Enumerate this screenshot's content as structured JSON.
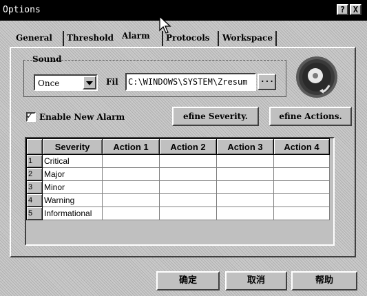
{
  "window": {
    "title": "Options",
    "help_glyph": "?",
    "close_glyph": "X"
  },
  "tabs": [
    {
      "label": "General"
    },
    {
      "label": "Threshold"
    },
    {
      "label": "Alarm"
    },
    {
      "label": "Protocols"
    },
    {
      "label": "Workspace"
    }
  ],
  "active_tab": "Alarm",
  "sound": {
    "group_label": "Sound",
    "mode": "Once",
    "file_label": "Fil",
    "file_value": "C:\\WINDOWS\\SYSTEM\\Zresum",
    "browse_label": "..."
  },
  "enable_alarm": {
    "label": "Enable New Alarm",
    "checked": true,
    "check_glyph": "✓"
  },
  "buttons": {
    "define_severity": "efine Severity.",
    "define_actions": "efine Actions."
  },
  "table": {
    "columns": [
      "",
      "Severity",
      "Action 1",
      "Action 2",
      "Action 3",
      "Action 4"
    ],
    "rows": [
      {
        "num": "1",
        "severity": "Critical"
      },
      {
        "num": "2",
        "severity": "Major"
      },
      {
        "num": "3",
        "severity": "Minor"
      },
      {
        "num": "4",
        "severity": "Warning"
      },
      {
        "num": "5",
        "severity": "Informational"
      }
    ]
  },
  "footer": {
    "ok": "确定",
    "cancel": "取消",
    "help": "帮助"
  },
  "icons": {
    "alarm": "alarm-dial-icon",
    "cursor": "mouse-pointer-icon"
  }
}
